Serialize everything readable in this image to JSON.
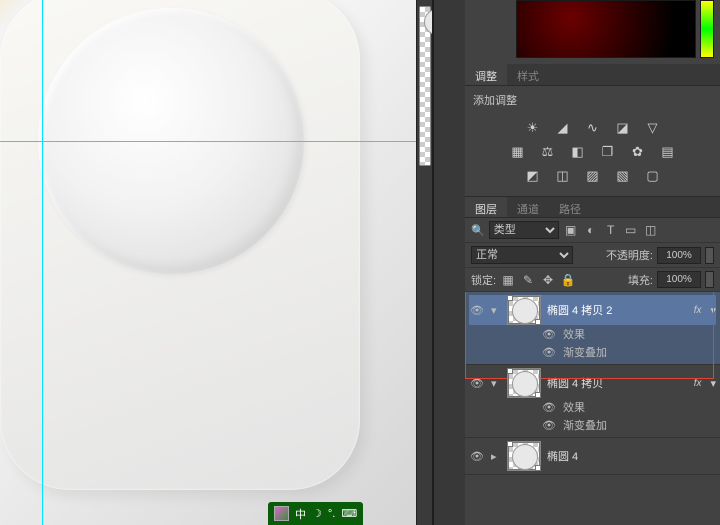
{
  "tabs_adjust": {
    "t1": "调整",
    "t2": "样式"
  },
  "adjust_title": "添加调整",
  "adj_icons": [
    [
      "sun-icon",
      "levels-icon",
      "curves-icon",
      "exposure-icon",
      "triangle-icon"
    ],
    [
      "vibrance-icon",
      "balance-icon",
      "bw-icon",
      "overlap-icon",
      "rgb-icon",
      "grid-icon"
    ],
    [
      "invert-icon",
      "posterize-icon",
      "threshold-icon",
      "map-icon",
      "neutral-icon"
    ]
  ],
  "tabs_layers": {
    "t1": "图层",
    "t2": "通道",
    "t3": "路径"
  },
  "filter_label": "类型",
  "blend_label": "正常",
  "opacity_label": "不透明度:",
  "opacity_value": "100%",
  "lock_label": "锁定:",
  "fill_label": "填充:",
  "fill_value": "100%",
  "layers": [
    {
      "name": "椭圆 4 拷贝 2",
      "fx": true,
      "sub1": "效果",
      "sub2": "渐变叠加",
      "selected": true
    },
    {
      "name": "椭圆 4 拷贝",
      "fx": true,
      "sub1": "效果",
      "sub2": "渐变叠加",
      "selected": false
    },
    {
      "name": "椭圆 4",
      "fx": false,
      "selected": false
    }
  ],
  "taskbar": {
    "label": "中",
    "ime": "IME"
  }
}
